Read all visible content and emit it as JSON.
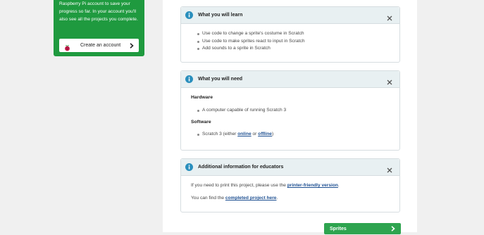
{
  "promo": {
    "text": "Raspberry Pi account to save your progress so far. In your account you'll also see all the projects you complete.",
    "button_label": "Create an account"
  },
  "learn": {
    "title": "What you will learn",
    "items": [
      "Use code to change a sprite's costume in Scratch",
      "Use code to make sprites react to input in Scratch",
      "Add sounds to a sprite in Scratch"
    ]
  },
  "need": {
    "title": "What you will need",
    "hardware_heading": "Hardware",
    "hardware_item": "A computer capable of running Scratch 3",
    "software_heading": "Software",
    "software_prefix": "Scratch 3 (either ",
    "software_online": "online",
    "software_or": " or ",
    "software_offline": "offline",
    "software_suffix": ")"
  },
  "educators": {
    "title": "Additional information for educators",
    "print_prefix": "If you need to print this project, please use the ",
    "print_link": "printer-friendly version",
    "print_suffix": ".",
    "find_prefix": "You can find the ",
    "find_link": "completed project here",
    "find_suffix": "."
  },
  "next_button": {
    "label": "Sprites"
  },
  "colors": {
    "promo_bg": "#1f9a3f",
    "panel_head_bg": "#e8f0f2",
    "info_icon": "#2a8fbd",
    "link": "#1d4f91",
    "next_button_bg": "#2ea44f"
  },
  "icons": {
    "info": "info-icon",
    "close": "close-icon",
    "chevron": "chevron-right-icon",
    "raspberry": "raspberry-pi-logo-icon"
  }
}
